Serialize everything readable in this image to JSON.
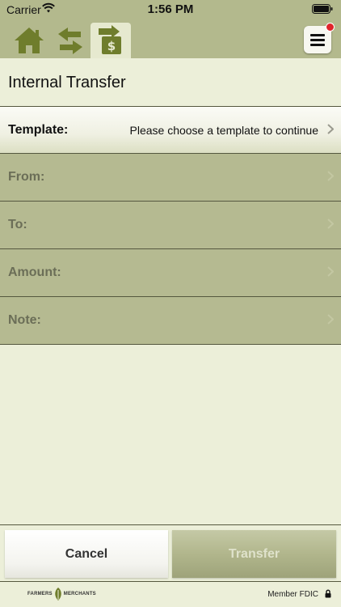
{
  "status_bar": {
    "carrier": "Carrier",
    "time": "1:56 PM"
  },
  "nav": {
    "tabs": [
      {
        "icon": "home-icon",
        "active": false
      },
      {
        "icon": "transfer-arrows-icon",
        "active": false
      },
      {
        "icon": "money-transfer-icon",
        "active": true
      }
    ],
    "menu_icon": "hamburger-menu-icon",
    "menu_badge_color": "#e0242b"
  },
  "page": {
    "title": "Internal Transfer"
  },
  "form": {
    "rows": [
      {
        "label": "Template:",
        "value": "Please choose a template to continue",
        "enabled": true
      },
      {
        "label": "From:",
        "value": "",
        "enabled": false
      },
      {
        "label": "To:",
        "value": "",
        "enabled": false
      },
      {
        "label": "Amount:",
        "value": "",
        "enabled": false
      },
      {
        "label": "Note:",
        "value": "",
        "enabled": false
      }
    ]
  },
  "buttons": {
    "cancel_label": "Cancel",
    "transfer_label": "Transfer"
  },
  "footer": {
    "logo_left": "FARMERS",
    "logo_right": "MERCHANTS",
    "member_fdic": "Member FDIC"
  },
  "colors": {
    "brand_green": "#b3b98d",
    "dark_green": "#6f7d2c",
    "background": "#ecefd9"
  }
}
